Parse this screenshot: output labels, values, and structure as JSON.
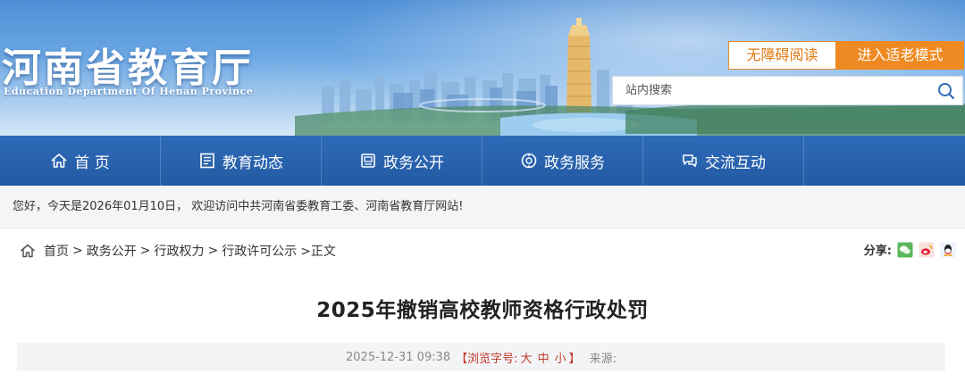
{
  "header": {
    "title": "河南省教育厅",
    "subtitle": "Education Department Of Henan Province",
    "accessibility_label": "无障碍阅读",
    "elder_mode_label": "进入适老模式",
    "search": {
      "placeholder": "站内搜索",
      "icon": "search-icon"
    }
  },
  "nav": {
    "items": [
      {
        "label": "首 页",
        "icon": "home-icon"
      },
      {
        "label": "教育动态",
        "icon": "news-icon"
      },
      {
        "label": "政务公开",
        "icon": "document-icon"
      },
      {
        "label": "政务服务",
        "icon": "service-icon"
      },
      {
        "label": "交流互动",
        "icon": "chat-icon"
      }
    ]
  },
  "welcome_text": "您好，今天是2026年01月10日， 欢迎访问中共河南省委教育工委、河南省教育厅网站!",
  "breadcrumb": {
    "items": [
      "首页",
      "政务公开",
      "行政权力",
      "行政许可公示"
    ],
    "separator": ">",
    "current": ">正文"
  },
  "share": {
    "label": "分享:",
    "icons": [
      "wechat-icon",
      "weibo-icon",
      "qq-icon"
    ]
  },
  "article": {
    "title": "2025年撤销高校教师资格行政处罚",
    "date": "2025-12-31 09:38",
    "font_size_label": "【浏览字号:",
    "font_sizes": [
      "大",
      "中",
      "小"
    ],
    "font_size_close": "】",
    "source_label": "来源:"
  },
  "colors": {
    "nav_bg": "#235aa3",
    "accent_orange": "#ef8a22",
    "font_size_red": "#c0392b"
  }
}
